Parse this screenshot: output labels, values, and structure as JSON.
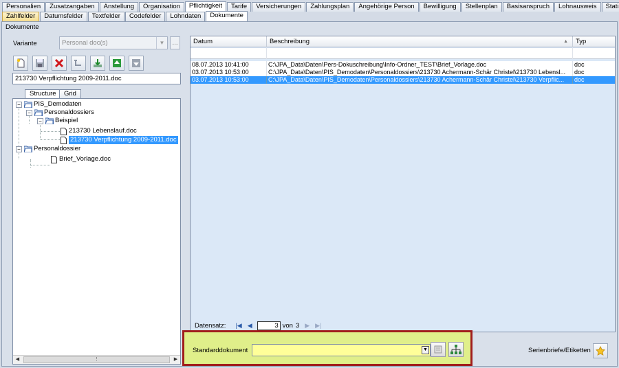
{
  "main_tabs": [
    "Personalien",
    "Zusatzangaben",
    "Anstellung",
    "Organisation",
    "Pflichtigkeit",
    "Tarife",
    "Versicherungen",
    "Zahlungsplan",
    "Angehörige Person",
    "Bewilligung",
    "Stellenplan",
    "Basisanspruch",
    "Lohnausweis",
    "Statistik"
  ],
  "sub_tabs": [
    "Zahlfelder",
    "Datumsfelder",
    "Textfelder",
    "Codefelder",
    "Lohndaten",
    "Dokumente"
  ],
  "active_sub_tab": "Dokumente",
  "section_title": "Dokumente",
  "variante": {
    "label": "Variante",
    "value": "Personal doc(s)",
    "more": "..."
  },
  "filename": "213730 Verpflichtung 2009-2011.doc",
  "tree_tabs": [
    "Structure",
    "Grid"
  ],
  "tree": {
    "root": "PIS_Demodaten",
    "folder1": "Personaldossiers",
    "folder1_sub": "Beispiel",
    "doc1": "213730 Lebenslauf.doc",
    "doc2": "213730 Verpflichtung 2009-2011.doc",
    "folder2": "Personaldossier",
    "doc3": "Brief_Vorlage.doc"
  },
  "grid": {
    "headers": {
      "datum": "Datum",
      "beschreibung": "Beschreibung",
      "typ": "Typ"
    },
    "rows": [
      {
        "datum": "08.07.2013 10:41:00",
        "beschreibung": "C:\\JPA_Data\\Daten\\Pers-Dokuschreibung\\Info-Ordner_TEST\\Brief_Vorlage.doc",
        "typ": "doc"
      },
      {
        "datum": "03.07.2013 10:53:00",
        "beschreibung": "C:\\JPA_Data\\Daten\\PIS_Demodaten\\Personaldossiers\\213730 Achermann-Schär Christel\\213730 Lebensl...",
        "typ": "doc"
      },
      {
        "datum": "03.07.2013 10:53:00",
        "beschreibung": "C:\\JPA_Data\\Daten\\PIS_Demodaten\\Personaldossiers\\213730 Achermann-Schär Christel\\213730 Verpflic...",
        "typ": "doc"
      }
    ],
    "nav": {
      "label": "Datensatz:",
      "current": "3",
      "of": "von",
      "total": "3"
    }
  },
  "standard": {
    "label": "Standarddokument",
    "value": ""
  },
  "serien": {
    "label": "Serienbriefe/Etiketten"
  },
  "colors": {
    "selection": "#3399ff",
    "highlight_panel": "#e0ef8a",
    "highlight_border": "#a01c1c",
    "std_input": "#ffff99"
  }
}
